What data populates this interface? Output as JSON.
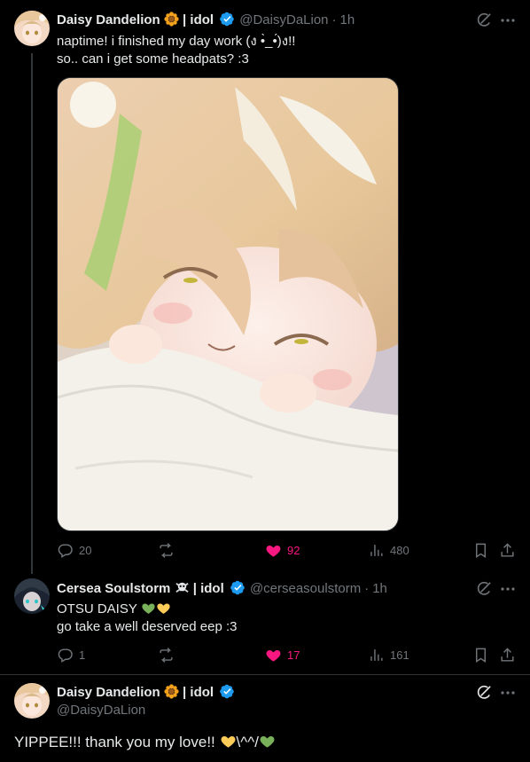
{
  "tweet1": {
    "name": "Daisy Dandelion",
    "name_suffix": "| idol",
    "handle": "@DaisyDaLion",
    "sep": "·",
    "time": "1h",
    "line1": "naptime! i finished my day work (ง •̀_•́)ง!!",
    "line2": "so.. can i get some headpats? :3",
    "stats": {
      "replies": "20",
      "retweets": "",
      "likes": "92",
      "views": "480"
    }
  },
  "tweet2": {
    "name": "Cersea Soulstorm",
    "name_suffix": "| idol",
    "handle": "@cerseasoulstorm",
    "sep": "·",
    "time": "1h",
    "line1": "OTSU DAISY",
    "line2": "go take a well deserved eep :3",
    "stats": {
      "replies": "1",
      "retweets": "",
      "likes": "17",
      "views": "161"
    }
  },
  "tweet3": {
    "name": "Daisy Dandelion",
    "name_suffix": "| idol",
    "handle": "@DaisyDaLion",
    "text_a": "YIPPEE!!! thank you my love!!",
    "text_b": "\\^^/"
  },
  "colors": {
    "like": "#f91880",
    "verified": "#1d9bf0",
    "muted": "#71767b",
    "text": "#e7e9ea"
  }
}
